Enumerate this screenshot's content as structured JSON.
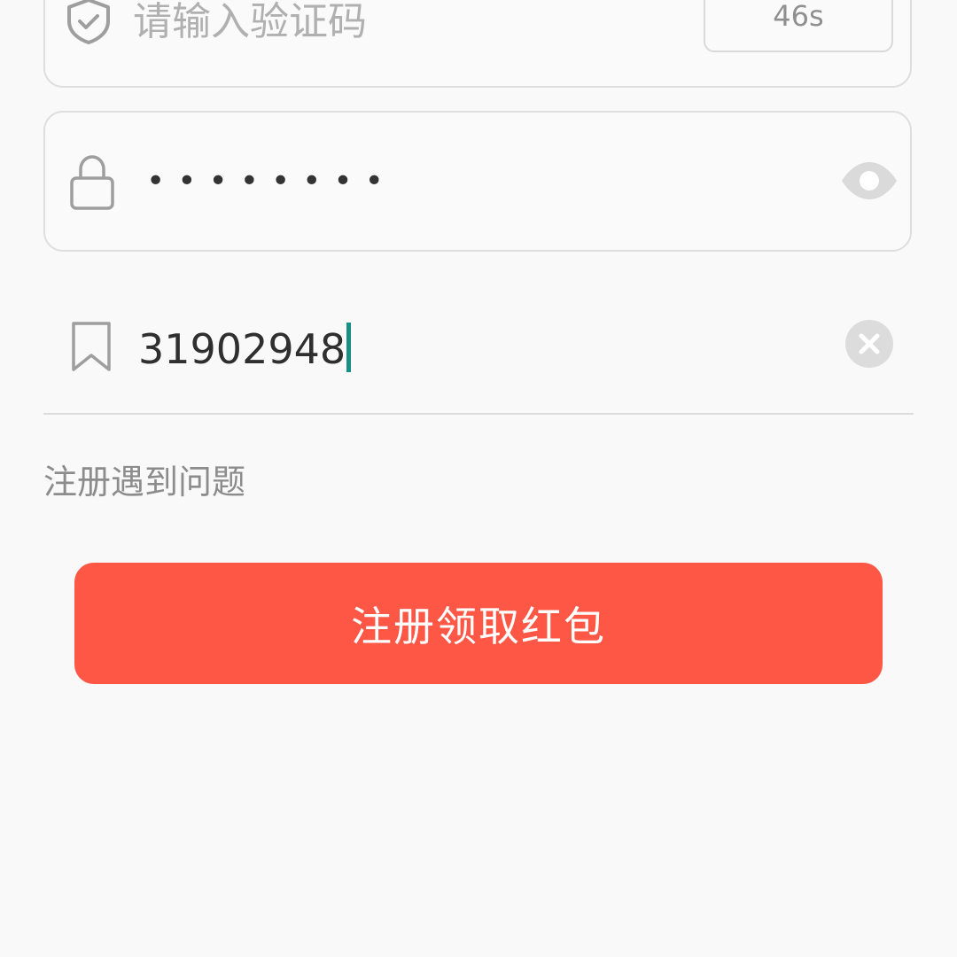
{
  "verification": {
    "placeholder": "请输入验证码",
    "countdown": "46s"
  },
  "password": {
    "masked_value": "••••••••"
  },
  "invite": {
    "value": "31902948"
  },
  "help": {
    "label": "注册遇到问题"
  },
  "submit": {
    "label": "注册领取红包"
  },
  "colors": {
    "accent": "#ff5746",
    "cursor": "#1a8f86",
    "border": "#dedede",
    "background": "#f9f9f9"
  },
  "icons": {
    "verification": "shield-check-icon",
    "password": "lock-icon",
    "visibility": "eye-icon",
    "invite": "bookmark-icon",
    "clear": "clear-icon"
  }
}
